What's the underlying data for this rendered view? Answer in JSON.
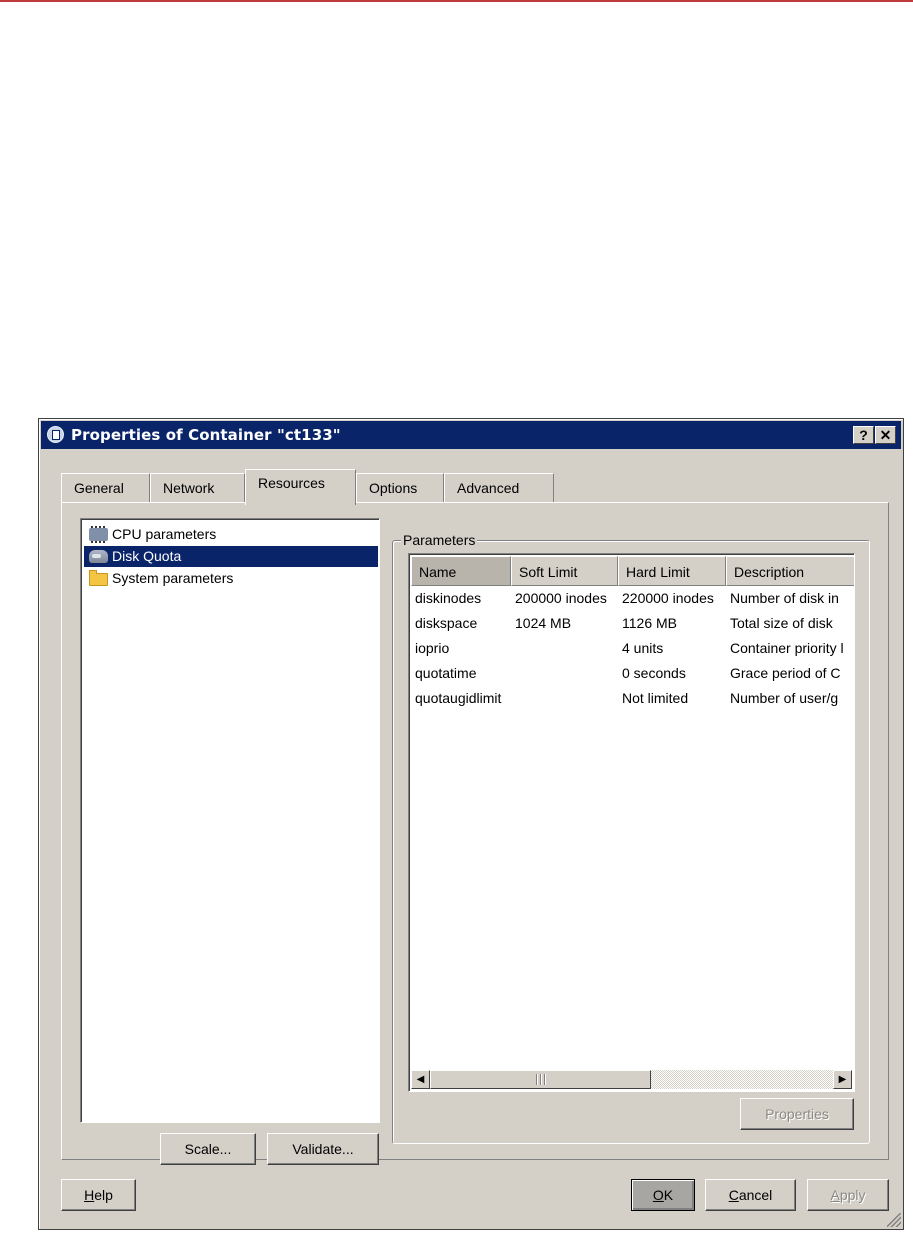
{
  "window": {
    "title": "Properties of Container \"ct133\"",
    "help_button": "?",
    "close_button": "✕"
  },
  "tabs": [
    {
      "label": "General"
    },
    {
      "label": "Network"
    },
    {
      "label": "Resources",
      "active": true
    },
    {
      "label": "Options"
    },
    {
      "label": "Advanced"
    }
  ],
  "tree": {
    "items": [
      {
        "label": "CPU parameters",
        "icon": "cpu-chip-icon"
      },
      {
        "label": "Disk Quota",
        "icon": "disk-icon",
        "selected": true
      },
      {
        "label": "System parameters",
        "icon": "folder-icon"
      }
    ]
  },
  "left_buttons": {
    "scale": "Scale...",
    "validate": "Validate..."
  },
  "parameters": {
    "legend": "Parameters",
    "columns": [
      "Name",
      "Soft Limit",
      "Hard Limit",
      "Description"
    ],
    "rows": [
      [
        "diskinodes",
        "200000 inodes",
        "220000 inodes",
        "Number of disk in"
      ],
      [
        "diskspace",
        "1024 MB",
        "1126 MB",
        "Total size of disk"
      ],
      [
        "ioprio",
        "",
        "4 units",
        "Container priority l"
      ],
      [
        "quotatime",
        "",
        "0 seconds",
        "Grace period of C"
      ],
      [
        "quotaugidlimit",
        "",
        "Not limited",
        "Number of user/g"
      ]
    ],
    "properties_button": "Properties"
  },
  "footer": {
    "help": {
      "prefix": "",
      "accel": "H",
      "rest": "elp"
    },
    "ok": {
      "prefix": "",
      "accel": "O",
      "rest": "K"
    },
    "cancel": {
      "prefix": "",
      "accel": "C",
      "rest": "ancel"
    },
    "apply": {
      "prefix": "",
      "accel": "A",
      "rest": "pply"
    }
  },
  "colors": {
    "title_bar": "#0a246a",
    "dialog_face": "#d4d0c8",
    "selection": "#0a246a",
    "top_rule": "#c0393b"
  }
}
